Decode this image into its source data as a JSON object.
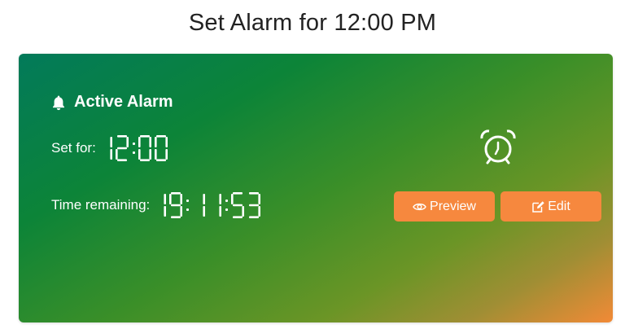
{
  "page": {
    "title": "Set Alarm for 12:00 PM"
  },
  "card": {
    "header_icon": "bell-icon",
    "header_title": "Active Alarm",
    "set_for_label": "Set for:",
    "set_for_time": "12:00",
    "remaining_label": "Time remaining:",
    "remaining_time": "19:11:53",
    "status_icon": "alarm-clock-icon",
    "colors": {
      "gradient_start": "#027a5a",
      "gradient_end": "#f28a36",
      "button": "#f6883e"
    }
  },
  "actions": {
    "preview_icon": "eye-icon",
    "preview_label": "Preview",
    "edit_icon": "edit-icon",
    "edit_label": "Edit"
  }
}
